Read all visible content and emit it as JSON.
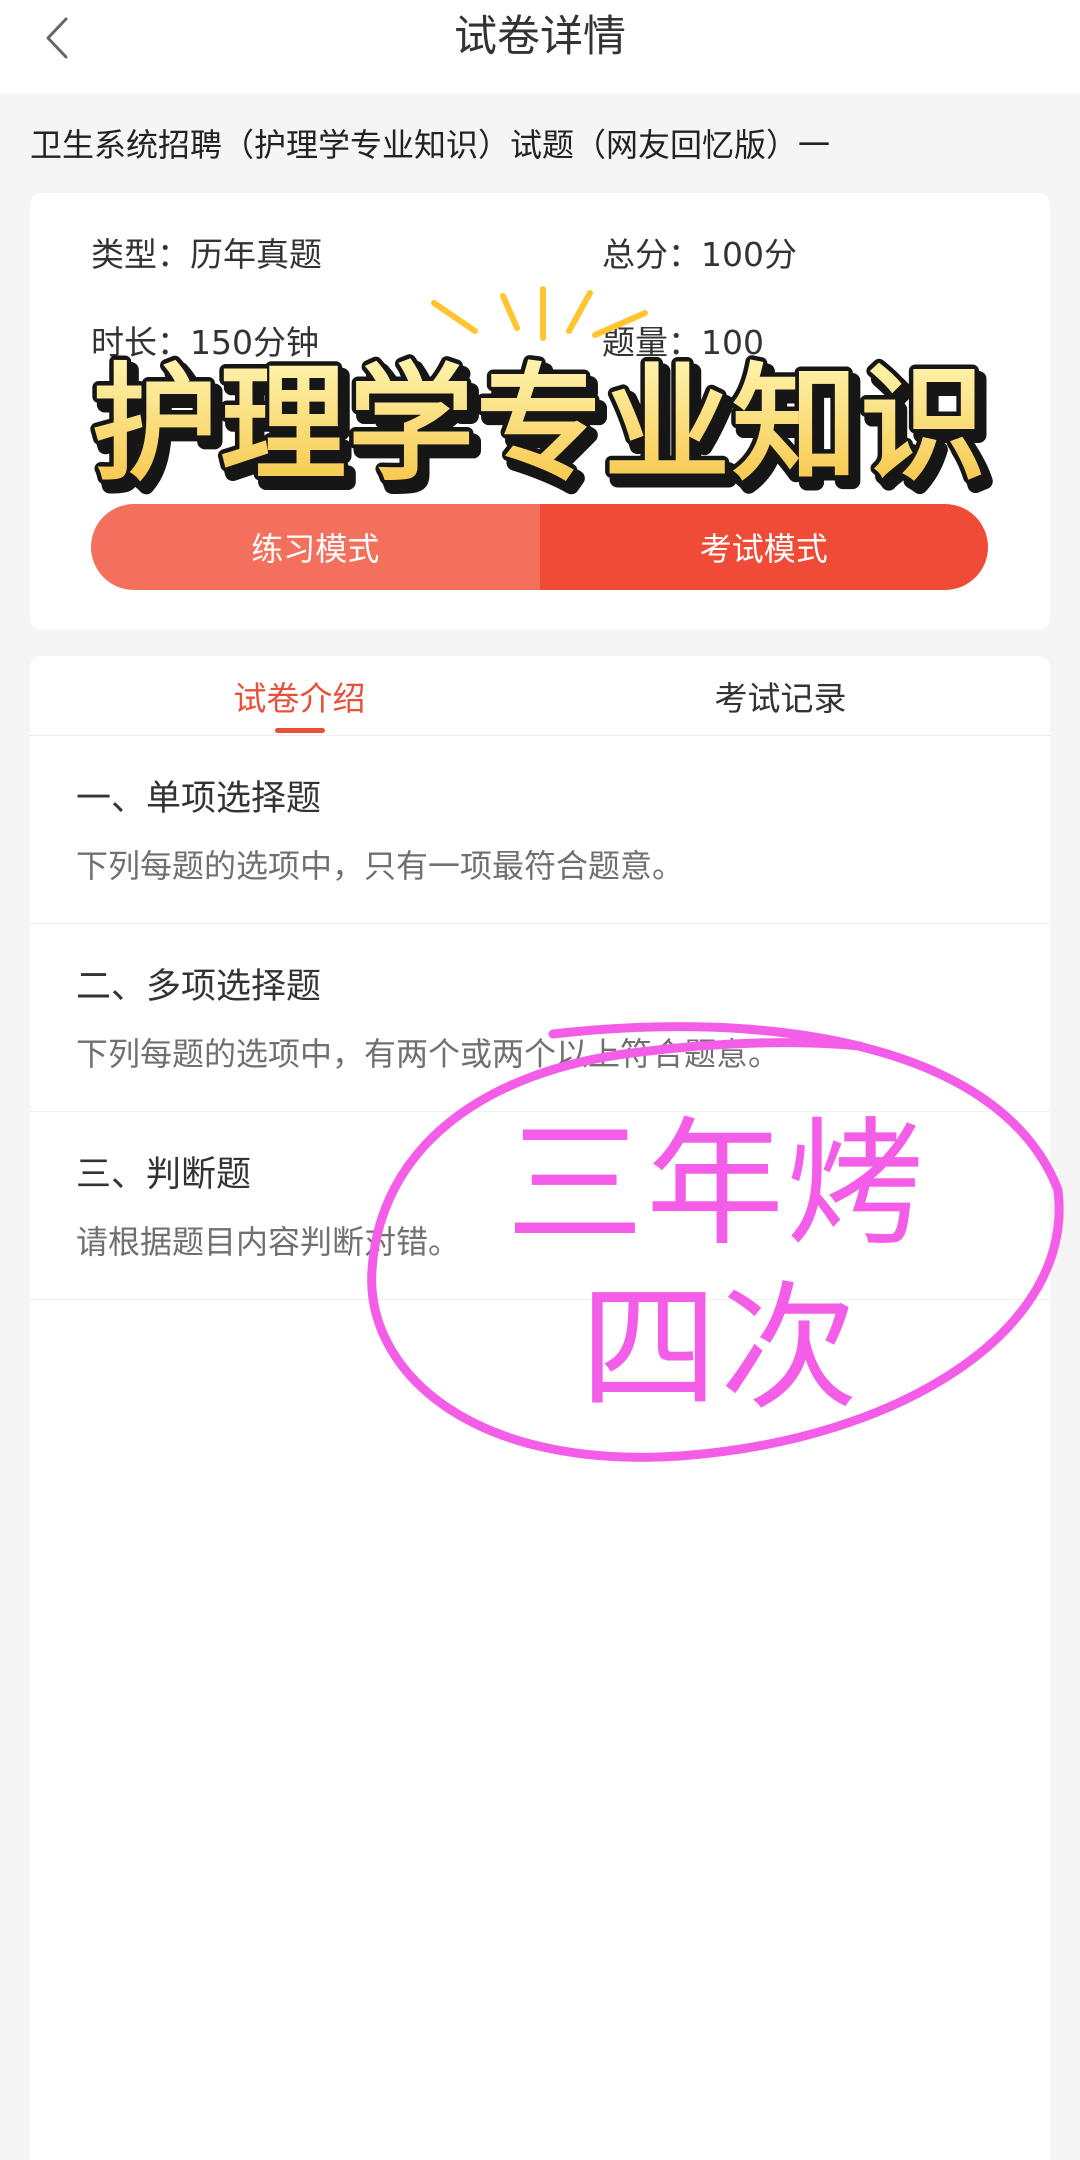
{
  "header": {
    "back_icon": "chevron-left-icon",
    "title": "试卷详情"
  },
  "paper": {
    "title": "卫生系统招聘（护理学专业知识）试题（网友回忆版）一"
  },
  "info": {
    "type": {
      "label": "类型：",
      "value": "历年真题"
    },
    "total_score": {
      "label": "总分：",
      "value": "100分"
    },
    "duration": {
      "label": "时长：",
      "value": "150分钟"
    },
    "question_count": {
      "label": "题量：",
      "value": "100"
    }
  },
  "banner": {
    "text": "护理学专业知识"
  },
  "modes": {
    "practice_label": "练习模式",
    "exam_label": "考试模式"
  },
  "tabs": [
    {
      "label": "试卷介绍",
      "active": true
    },
    {
      "label": "考试记录",
      "active": false
    }
  ],
  "sections": [
    {
      "title": "一、单项选择题",
      "desc": "下列每题的选项中，只有一项最符合题意。"
    },
    {
      "title": "二、多项选择题",
      "desc": "下列每题的选项中，有两个或两个以上符合题意。"
    },
    {
      "title": "三、判断题",
      "desc": "请根据题目内容判断对错。"
    }
  ],
  "annotation": {
    "line_1": "三年烤",
    "line_2": "四次"
  },
  "colors": {
    "accent": "#e8503a",
    "practice_button": "#f3705c",
    "exam_button": "#ef4b36",
    "banner_fill_top": "#fff6b3",
    "banner_fill_bottom": "#f6c443",
    "sparkle": "#ffc530",
    "page_background": "#f5f5f5",
    "annotation": "#f35de8"
  }
}
